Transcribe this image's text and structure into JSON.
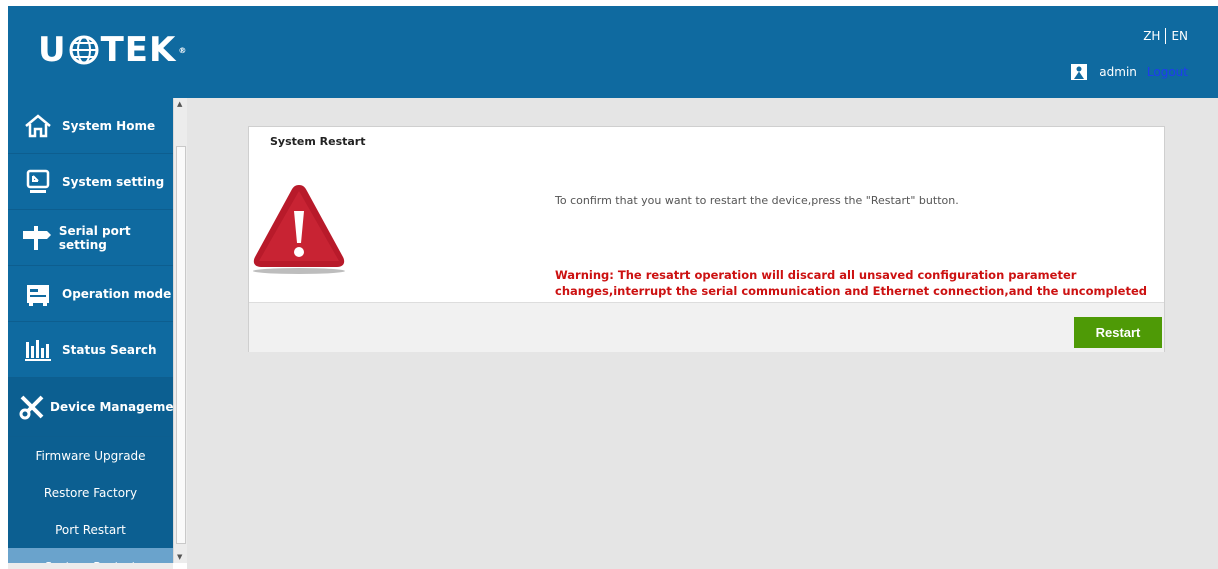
{
  "header": {
    "logo": "USOTEK",
    "lang_zh": "ZH",
    "lang_en": "EN",
    "username": "admin",
    "logout": "Logout"
  },
  "sidebar": {
    "items": [
      {
        "label": "System Home",
        "icon": "home-icon"
      },
      {
        "label": "System setting",
        "icon": "monitor-icon"
      },
      {
        "label": "Serial port setting",
        "icon": "signpost-icon"
      },
      {
        "label": "Operation mode",
        "icon": "machine-icon"
      },
      {
        "label": "Status Search",
        "icon": "bar-chart-icon"
      },
      {
        "label": "Device Management",
        "icon": "tools-icon"
      }
    ],
    "subitems": [
      {
        "label": "Firmware Upgrade"
      },
      {
        "label": "Restore Factory"
      },
      {
        "label": "Port Restart"
      },
      {
        "label": "System Restart",
        "active": true
      }
    ]
  },
  "panel": {
    "title": "System Restart",
    "confirm_text": "To confirm that you want to restart the device,press the \"Restart\" button.",
    "warning_text": "Warning: The resatrt operation will discard all unsaved configuration parameter changes,interrupt the serial communication and Ethernet connection,and the uncompleted data may be lost.",
    "restart_button": "Restart"
  },
  "colors": {
    "header_bg": "#0f6aa0",
    "button_green": "#4e9a06",
    "warning_red": "#cc1111",
    "active_sub": "#6aa3cc"
  }
}
